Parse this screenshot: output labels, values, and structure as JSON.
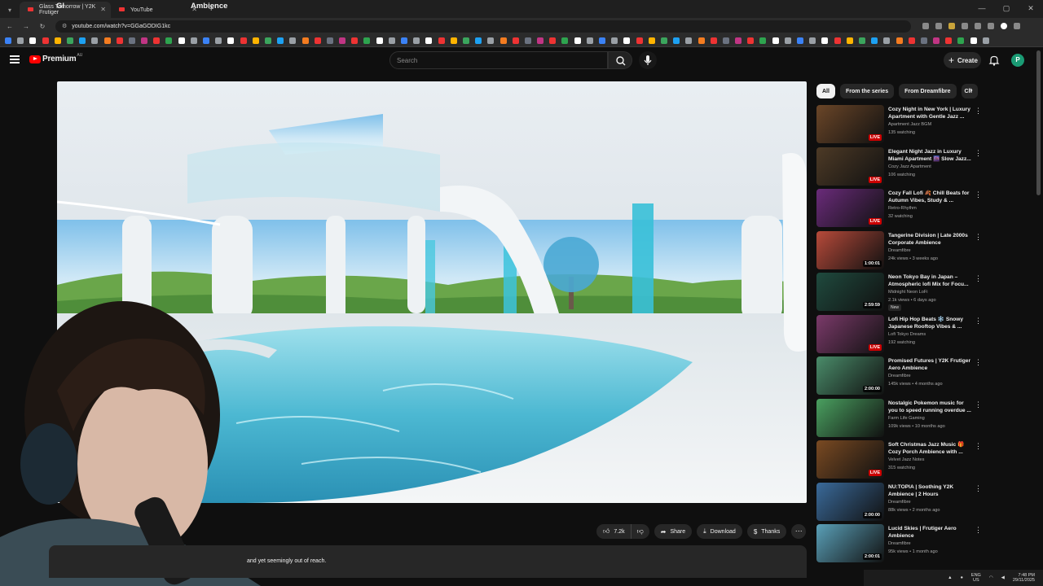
{
  "browser": {
    "tabs": [
      {
        "title": "Glass Tomorrow | Y2K Frutiger"
      },
      {
        "title": "YouTube"
      }
    ],
    "url": "youtube.com/watch?v=GGaGODIG1kc"
  },
  "masthead": {
    "logo_text": "Premium",
    "logo_country": "AU",
    "search_placeholder": "Search",
    "create_label": "Create",
    "avatar_letter": "P"
  },
  "video": {
    "title_visible_left": "Gl",
    "title_visible_right": "Ambience",
    "description_visible": "and yet seemingly out of reach.",
    "actions": {
      "like_count": "7.2k",
      "share_label": "Share",
      "download_label": "Download",
      "thanks_label": "Thanks"
    }
  },
  "sidebar": {
    "chips": [
      "All",
      "From the series",
      "From Dreamfibre",
      "Ch"
    ],
    "items": [
      {
        "title": "Cozy Night in New York | Luxury Apartment with Gentle Jazz ...",
        "channel": "Apartment Jazz BGM",
        "meta": "135 watching",
        "badge": "LIVE",
        "live": true,
        "thumb": "#6b4628"
      },
      {
        "title": "Elegant Night Jazz in Luxury Miami Apartment 🌆 Slow Jazz...",
        "channel": "Cozy Jazz Apartment",
        "meta": "106 watching",
        "badge": "LIVE",
        "live": true,
        "thumb": "#4d3a26"
      },
      {
        "title": "Cozy Fall Lofi 🍂 Chill Beats for Autumn Vibes, Study & ...",
        "channel": "Retro-Rhythm",
        "meta": "32 watching",
        "badge": "LIVE",
        "live": true,
        "thumb": "#6a2b7a"
      },
      {
        "title": "Tangerine Division | Late 2000s Corporate Ambience",
        "channel": "Dreamfibre",
        "meta": "24k views • 3 weeks ago",
        "badge": "1:00:01",
        "live": false,
        "thumb": "#b74a3a"
      },
      {
        "title": "Neon Tokyo Bay in Japan – Atmospheric lofi Mix for Focu...",
        "channel": "Midnight Neon LoFi",
        "meta": "2.1k views • 6 days ago",
        "badge": "2:59:59",
        "live": false,
        "new": "New",
        "thumb": "#1f4a3e"
      },
      {
        "title": "Lofi Hip Hop Beats ❄️ Snowy Japanese Rooftop Vibes & ...",
        "channel": "Lofi Tokyo Dreams",
        "meta": "192 watching",
        "badge": "LIVE",
        "live": true,
        "thumb": "#7b3a6a"
      },
      {
        "title": "Promised Futures | Y2K Frutiger Aero Ambience",
        "channel": "Dreamfibre",
        "meta": "145k views • 4 months ago",
        "badge": "2:00:00",
        "live": false,
        "thumb": "#4a8c6a"
      },
      {
        "title": "Nostalgic Pokemon music for you to speed running overdue ...",
        "channel": "Farm Life Gaming",
        "meta": "109k views • 10 months ago",
        "badge": "",
        "live": false,
        "thumb": "#4aa060"
      },
      {
        "title": "Soft Christmas Jazz Music 🎁 Cozy Porch Ambience with ...",
        "channel": "Velvet Jazz Notes",
        "meta": "315 watching",
        "badge": "LIVE",
        "live": true,
        "thumb": "#7a4a22"
      },
      {
        "title": "NU:TOPIA | Soothing Y2K Ambience | 2 Hours",
        "channel": "Dreamfibre",
        "meta": "88k views • 2 months ago",
        "badge": "2:00:00",
        "live": false,
        "thumb": "#3a6a9a"
      },
      {
        "title": "Lucid Skies | Frutiger Aero Ambience",
        "channel": "Dreamfibre",
        "meta": "95k views • 1 month ago",
        "badge": "2:00:01",
        "live": false,
        "thumb": "#5aa0b8"
      }
    ]
  },
  "taskbar": {
    "lang_top": "ENG",
    "lang_bottom": "US",
    "time": "7:48 PM",
    "date": "29/11/2025"
  },
  "colors": {
    "bg": "#0f0f0f",
    "surface": "#272727",
    "brand_red": "#ff0000",
    "live_red": "#cc0000",
    "avatar": "#1a9b74"
  }
}
